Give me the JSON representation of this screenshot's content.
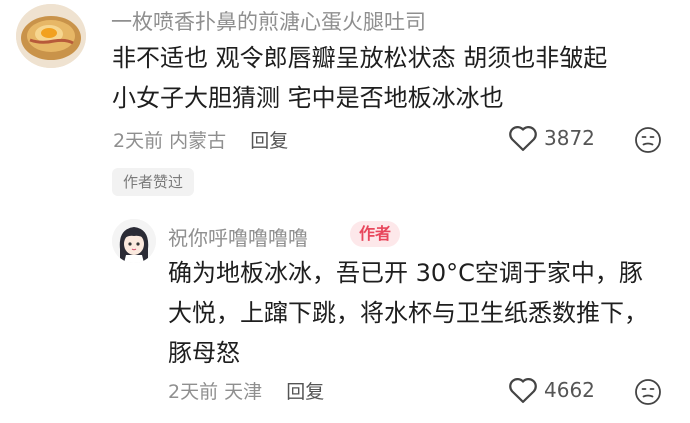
{
  "comment": {
    "username": "一枚喷香扑鼻的煎溏心蛋火腿吐司",
    "lines": [
      "非不适也 观令郎唇瓣呈放松状态 胡须也非皱起",
      "小女子大胆猜测 宅中是否地板冰冰也"
    ],
    "meta": {
      "time": "2天前",
      "location": "内蒙古",
      "reply_label": "回复"
    },
    "like_count": "3872",
    "liked_by_author_label": "作者赞过"
  },
  "reply": {
    "username": "祝你呼噜噜噜噜",
    "author_badge": "作者",
    "text": "确为地板冰冰，吾已开 30°C空调于家中，豚大悦，上蹿下跳，将水杯与卫生纸悉数推下，豚母怒",
    "meta": {
      "time": "2天前",
      "location": "天津",
      "reply_label": "回复"
    },
    "like_count": "4662"
  },
  "icons": {
    "like": "heart-outline-icon",
    "dislike": "unhappy-face-icon"
  },
  "colors": {
    "author_badge_bg": "#fde8ea",
    "author_badge_text": "#e8475c",
    "muted_text": "#8f8f8f"
  }
}
